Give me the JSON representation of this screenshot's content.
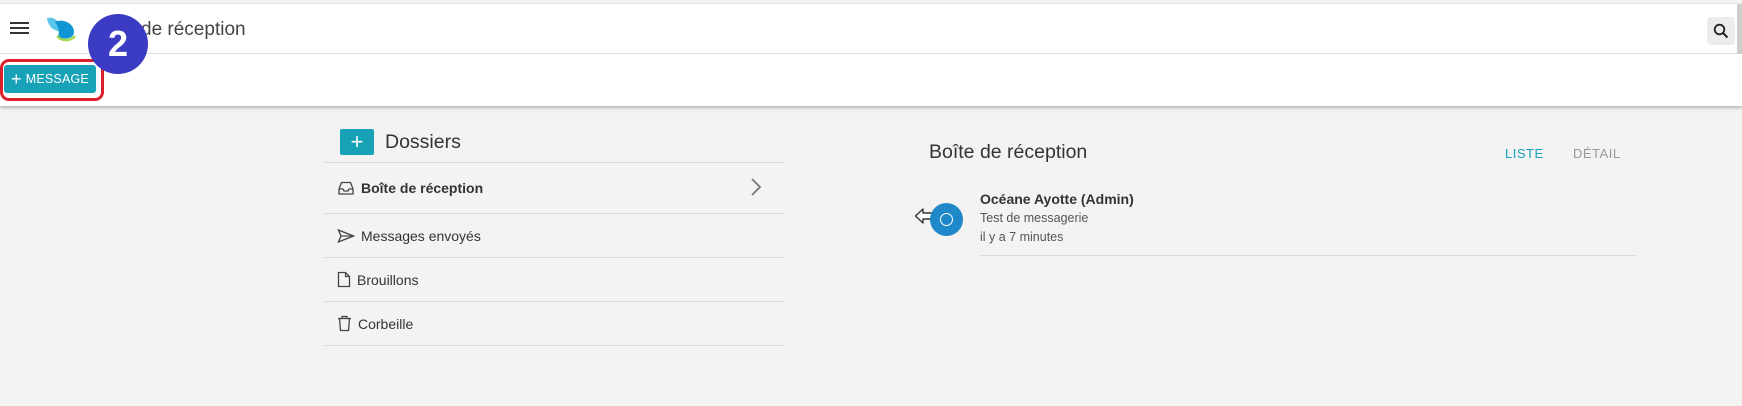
{
  "header": {
    "title": "de réception",
    "menu_icon": "hamburger-icon",
    "logo_icon": "app-logo",
    "search_icon": "search-icon"
  },
  "toolbar": {
    "new_message_label": "MESSAGE",
    "step_number": "2"
  },
  "folders": {
    "title": "Dossiers",
    "items": [
      {
        "label": "Boîte de réception",
        "icon": "inbox-icon",
        "active": true
      },
      {
        "label": "Messages envoyés",
        "icon": "send-icon"
      },
      {
        "label": "Brouillons",
        "icon": "draft-icon"
      },
      {
        "label": "Corbeille",
        "icon": "trash-icon"
      }
    ]
  },
  "inbox": {
    "title": "Boîte de réception",
    "tabs": [
      {
        "label": "LISTE",
        "active": true
      },
      {
        "label": "DÉTAIL",
        "active": false
      }
    ],
    "messages": [
      {
        "sender": "Océane Ayotte (Admin)",
        "subject": "Test de messagerie",
        "time": "il y a 7 minutes"
      }
    ]
  },
  "colors": {
    "accent": "#17a2b8",
    "highlight": "#d9202b",
    "badge": "#3b3bc4",
    "avatar": "#1f88c9"
  }
}
